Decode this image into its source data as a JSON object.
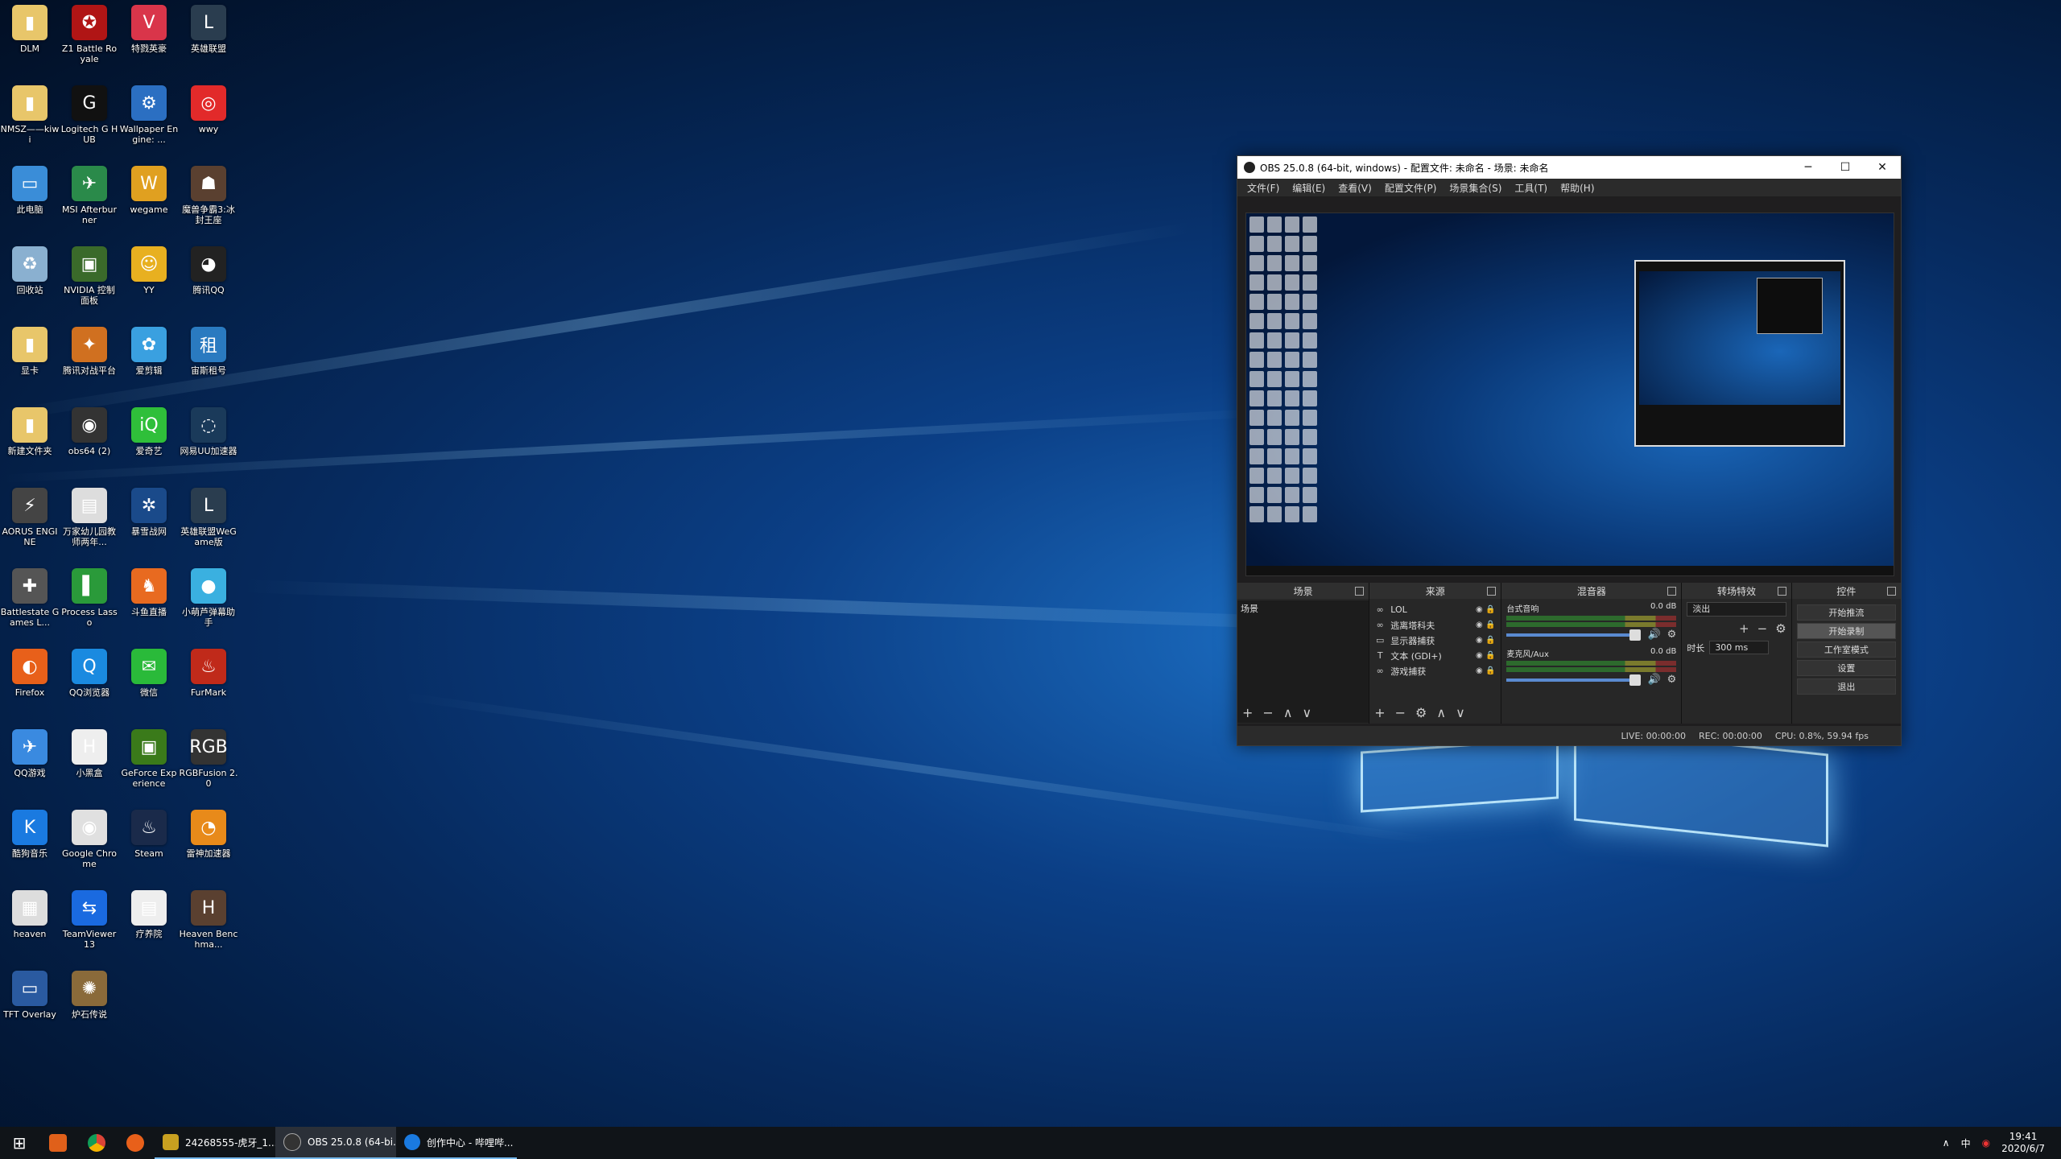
{
  "desktop": {
    "icons": [
      {
        "label": "DLM",
        "color": "#e8c66a",
        "glyph": "▮"
      },
      {
        "label": "Z1 Battle Royale",
        "color": "#b01515",
        "glyph": "✪"
      },
      {
        "label": "特戮英豪",
        "color": "#d9354a",
        "glyph": "V"
      },
      {
        "label": "英雄联盟",
        "color": "#2a3d4f",
        "glyph": "L"
      },
      {
        "label": "NMSZ——kiwi",
        "color": "#e8c66a",
        "glyph": "▮"
      },
      {
        "label": "Logitech G HUB",
        "color": "#111111",
        "glyph": "G"
      },
      {
        "label": "Wallpaper Engine: ...",
        "color": "#2b6fc2",
        "glyph": "⚙"
      },
      {
        "label": "wwy",
        "color": "#e22a2a",
        "glyph": "◎"
      },
      {
        "label": "此电脑",
        "color": "#3a8dd8",
        "glyph": "▭"
      },
      {
        "label": "MSI Afterburner",
        "color": "#2a8a4a",
        "glyph": "✈"
      },
      {
        "label": "wegame",
        "color": "#e0a020",
        "glyph": "W"
      },
      {
        "label": "魔兽争霸3:冰封王座",
        "color": "#5a4030",
        "glyph": "☗"
      },
      {
        "label": "回收站",
        "color": "#8ab0d0",
        "glyph": "♻"
      },
      {
        "label": "NVIDIA 控制面板",
        "color": "#3a6a2a",
        "glyph": "▣"
      },
      {
        "label": "YY",
        "color": "#e8b020",
        "glyph": "☺"
      },
      {
        "label": "腾讯QQ",
        "color": "#222222",
        "glyph": "◕"
      },
      {
        "label": "显卡",
        "color": "#e8c66a",
        "glyph": "▮"
      },
      {
        "label": "腾讯对战平台",
        "color": "#d07020",
        "glyph": "✦"
      },
      {
        "label": "爱剪辑",
        "color": "#3aa0e0",
        "glyph": "✿"
      },
      {
        "label": "宙斯租号",
        "color": "#2a7ac0",
        "glyph": "租"
      },
      {
        "label": "新建文件夹",
        "color": "#e8c66a",
        "glyph": "▮"
      },
      {
        "label": "obs64 (2)",
        "color": "#333333",
        "glyph": "◉"
      },
      {
        "label": "爱奇艺",
        "color": "#2fbf3a",
        "glyph": "iQ"
      },
      {
        "label": "网易UU加速器",
        "color": "#1a3a5a",
        "glyph": "◌"
      },
      {
        "label": "AORUS ENGINE",
        "color": "#444444",
        "glyph": "⚡"
      },
      {
        "label": "万家幼儿园教师两年...",
        "color": "#dddddd",
        "glyph": "▤"
      },
      {
        "label": "暴雪战网",
        "color": "#1a4a8a",
        "glyph": "✲"
      },
      {
        "label": "英雄联盟WeGame版",
        "color": "#2a3d4f",
        "glyph": "L"
      },
      {
        "label": "Battlestate Games L...",
        "color": "#555555",
        "glyph": "✚"
      },
      {
        "label": "Process Lasso",
        "color": "#2a9a3a",
        "glyph": "▌"
      },
      {
        "label": "斗鱼直播",
        "color": "#e86a20",
        "glyph": "♞"
      },
      {
        "label": "小萌芦弹幕助手",
        "color": "#3ab0e0",
        "glyph": "●"
      },
      {
        "label": "Firefox",
        "color": "#e8601a",
        "glyph": "◐"
      },
      {
        "label": "QQ浏览器",
        "color": "#1a8ae0",
        "glyph": "Q"
      },
      {
        "label": "微信",
        "color": "#2aba3a",
        "glyph": "✉"
      },
      {
        "label": "FurMark",
        "color": "#c02a1a",
        "glyph": "♨"
      },
      {
        "label": "QQ游戏",
        "color": "#3a8ae0",
        "glyph": "✈"
      },
      {
        "label": "小黑盒",
        "color": "#eeeeee",
        "glyph": "H"
      },
      {
        "label": "GeForce Experience",
        "color": "#3a7a1a",
        "glyph": "▣"
      },
      {
        "label": "RGBFusion 2.0",
        "color": "#333333",
        "glyph": "RGB"
      },
      {
        "label": "酷狗音乐",
        "color": "#1a7ae0",
        "glyph": "K"
      },
      {
        "label": "Google Chrome",
        "color": "#e0e0e0",
        "glyph": "◉"
      },
      {
        "label": "Steam",
        "color": "#1a2a4a",
        "glyph": "♨"
      },
      {
        "label": "雷神加速器",
        "color": "#e88a1a",
        "glyph": "◔"
      },
      {
        "label": "heaven",
        "color": "#dddddd",
        "glyph": "▦"
      },
      {
        "label": "TeamViewer 13",
        "color": "#1a6ae0",
        "glyph": "⇆"
      },
      {
        "label": "疗养院",
        "color": "#eeeeee",
        "glyph": "▤"
      },
      {
        "label": "Heaven Benchma...",
        "color": "#5a4030",
        "glyph": "H"
      },
      {
        "label": "TFT Overlay",
        "color": "#2a5aa0",
        "glyph": "▭"
      },
      {
        "label": "炉石传说",
        "color": "#8a6a3a",
        "glyph": "✺"
      }
    ]
  },
  "obs": {
    "title": "OBS 25.0.8 (64-bit, windows) - 配置文件: 未命名 - 场景: 未命名",
    "menu": [
      "文件(F)",
      "编辑(E)",
      "查看(V)",
      "配置文件(P)",
      "场景集合(S)",
      "工具(T)",
      "帮助(H)"
    ],
    "docks": {
      "scenes": {
        "title": "场景",
        "items": [
          "场景"
        ]
      },
      "sources": {
        "title": "来源",
        "items": [
          {
            "name": "LOL",
            "icon": "∞"
          },
          {
            "name": "逃离塔科夫",
            "icon": "∞"
          },
          {
            "name": "显示器捕获",
            "icon": "▭"
          },
          {
            "name": "文本 (GDI+)",
            "icon": "T"
          },
          {
            "name": "游戏捕获",
            "icon": "∞"
          }
        ]
      },
      "mixer": {
        "title": "混音器",
        "channels": [
          {
            "name": "台式音响",
            "db": "0.0 dB"
          },
          {
            "name": "麦克风/Aux",
            "db": "0.0 dB"
          }
        ]
      },
      "transitions": {
        "title": "转场特效",
        "selected": "淡出",
        "duration_label": "时长",
        "duration_value": "300 ms"
      },
      "controls": {
        "title": "控件",
        "buttons": [
          "开始推流",
          "开始录制",
          "工作室模式",
          "设置",
          "退出"
        ]
      }
    },
    "status": {
      "live": "LIVE: 00:00:00",
      "rec": "REC: 00:00:00",
      "cpu": "CPU: 0.8%, 59.94 fps"
    }
  },
  "taskbar": {
    "tasks": [
      {
        "label": "24268555-虎牙_1...",
        "color": "#c8a020"
      },
      {
        "label": "OBS 25.0.8 (64-bi...",
        "color": "#333333"
      },
      {
        "label": "创作中心 - 哔哩哔...",
        "color": "#1a7ae0"
      }
    ],
    "tray": {
      "ime": "中",
      "time": "19:41",
      "date": "2020/6/7"
    }
  }
}
